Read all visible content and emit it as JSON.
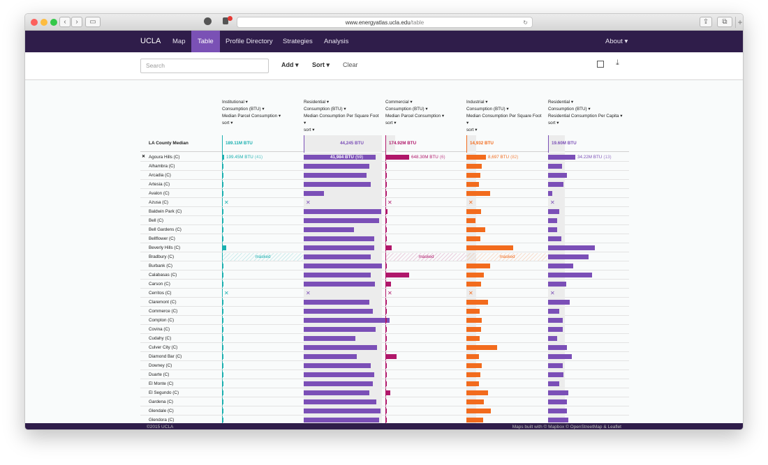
{
  "browser": {
    "url_host": "www.energyatlas.ucla.edu",
    "url_path": "/table"
  },
  "nav": {
    "brand": "UCLA",
    "items": [
      "Map",
      "Table",
      "Profile Directory",
      "Strategies",
      "Analysis"
    ],
    "about": "About ▾"
  },
  "toolbar": {
    "search_placeholder": "Search",
    "add": "Add ▾",
    "sort": "Sort ▾",
    "clear": "Clear"
  },
  "columns": [
    {
      "sector": "Institutional ▾",
      "metric": "Consumption (BTU) ▾",
      "measure": [
        "Median Parcel Consumption ▾"
      ],
      "sort": "sort ▾",
      "color": "#1bb0b0",
      "median": "189.11M BTU",
      "agoura_value": "199.45M BTU",
      "agoura_rank": "(41)"
    },
    {
      "sector": "Residential ▾",
      "metric": "Consumption (BTU) ▾",
      "measure": [
        "Median Consumption Per Square Foot",
        "▾"
      ],
      "sort": "sort ▾",
      "color": "#7b4fb7",
      "median": "44,245 BTU",
      "agoura_value": "41,984 BTU",
      "agoura_rank": "(59)"
    },
    {
      "sector": "Commercial ▾",
      "metric": "Consumption (BTU) ▾",
      "measure": [
        "Median Parcel Consumption ▾"
      ],
      "sort": "sort ▾",
      "color": "#b0176a",
      "median": "174.92M BTU",
      "agoura_value": "648.30M BTU",
      "agoura_rank": "(6)"
    },
    {
      "sector": "Industrial ▾",
      "metric": "Consumption (BTU) ▾",
      "measure": [
        "Median Consumption Per Square Foot",
        "▾"
      ],
      "sort": "sort ▾",
      "color": "#f26b1d",
      "median": "14,932 BTU",
      "agoura_value": "8,697 BTU",
      "agoura_rank": "(82)"
    },
    {
      "sector": "Residential ▾",
      "metric": "Consumption (BTU) ▾",
      "measure": [
        "Residential Consumption Per Capita ▾"
      ],
      "sort": "sort ▾",
      "color": "#7b4fb7",
      "median": "19.60M BTU",
      "agoura_value": "34.22M BTU",
      "agoura_rank": "(13)"
    }
  ],
  "median_label": "LA County Median",
  "masked_label": "masked",
  "close_mark": "✕",
  "rows": [
    {
      "name": "Agoura Hills (C)",
      "v": [
        0.03,
        0.92,
        0.3,
        0.25,
        0.35
      ]
    },
    {
      "name": "Alhambra (C)",
      "v": [
        0.01,
        0.84,
        0.02,
        0.2,
        0.18
      ]
    },
    {
      "name": "Arcadia (C)",
      "v": [
        0.01,
        0.8,
        0.02,
        0.18,
        0.24
      ]
    },
    {
      "name": "Artesia (C)",
      "v": [
        0.01,
        0.86,
        0.02,
        0.16,
        0.2
      ]
    },
    {
      "name": "Avalon (C)",
      "v": [
        0.01,
        0.26,
        0.01,
        0.3,
        0.05
      ]
    },
    {
      "name": "Azusa (C)",
      "v": null
    },
    {
      "name": "Baldwin Park (C)",
      "v": [
        0.01,
        0.99,
        0.03,
        0.19,
        0.14
      ]
    },
    {
      "name": "Bell (C)",
      "v": [
        0.02,
        0.96,
        0.02,
        0.12,
        0.12
      ]
    },
    {
      "name": "Bell Gardens (C)",
      "v": [
        0.01,
        0.64,
        0.02,
        0.24,
        0.12
      ]
    },
    {
      "name": "Bellflower (C)",
      "v": [
        0.01,
        0.9,
        0.02,
        0.18,
        0.17
      ]
    },
    {
      "name": "Beverly Hills (C)",
      "v": [
        0.05,
        0.9,
        0.08,
        0.6,
        0.6
      ]
    },
    {
      "name": "Bradbury (C)",
      "masked": true,
      "v": [
        0,
        0.86,
        0,
        0,
        0.52
      ]
    },
    {
      "name": "Burbank (C)",
      "v": [
        0.01,
        1.0,
        0.02,
        0.3,
        0.32
      ]
    },
    {
      "name": "Calabasas (C)",
      "v": [
        0.01,
        0.86,
        0.3,
        0.22,
        0.56
      ]
    },
    {
      "name": "Carson (C)",
      "v": [
        0.01,
        0.91,
        0.07,
        0.19,
        0.23
      ]
    },
    {
      "name": "Cerritos (C)",
      "v": null
    },
    {
      "name": "Claremont (C)",
      "v": [
        0.02,
        0.84,
        0.02,
        0.28,
        0.28
      ]
    },
    {
      "name": "Commerce (C)",
      "v": [
        0.01,
        0.88,
        0.02,
        0.17,
        0.14
      ]
    },
    {
      "name": "Compton (C)",
      "v": [
        0.01,
        1.1,
        0.02,
        0.2,
        0.19
      ]
    },
    {
      "name": "Covina (C)",
      "v": [
        0.01,
        0.92,
        0.02,
        0.19,
        0.19
      ]
    },
    {
      "name": "Cudahy (C)",
      "v": [
        0.01,
        0.66,
        0.02,
        0.17,
        0.12
      ]
    },
    {
      "name": "Culver City (C)",
      "v": [
        0.01,
        0.94,
        0.02,
        0.39,
        0.24
      ]
    },
    {
      "name": "Diamond Bar (C)",
      "v": [
        0.02,
        0.68,
        0.14,
        0.16,
        0.3
      ]
    },
    {
      "name": "Downey (C)",
      "v": [
        0.01,
        0.86,
        0.02,
        0.2,
        0.19
      ]
    },
    {
      "name": "Duarte (C)",
      "v": [
        0.01,
        0.9,
        0.02,
        0.18,
        0.2
      ]
    },
    {
      "name": "El Monte (C)",
      "v": [
        0.01,
        0.88,
        0.02,
        0.16,
        0.14
      ]
    },
    {
      "name": "El Segundo (C)",
      "v": [
        0.01,
        0.84,
        0.06,
        0.28,
        0.26
      ]
    },
    {
      "name": "Gardena (C)",
      "v": [
        0.01,
        0.93,
        0.02,
        0.22,
        0.24
      ]
    },
    {
      "name": "Glendale (C)",
      "v": [
        0.01,
        0.98,
        0.02,
        0.31,
        0.24
      ]
    },
    {
      "name": "Glendora (C)",
      "v": [
        0.01,
        0.96,
        0.02,
        0.21,
        0.26
      ]
    }
  ],
  "footer": {
    "left": "©2015 UCLA",
    "right": "Maps built with © Mapbox © OpenStreetMap & Leaflet"
  }
}
